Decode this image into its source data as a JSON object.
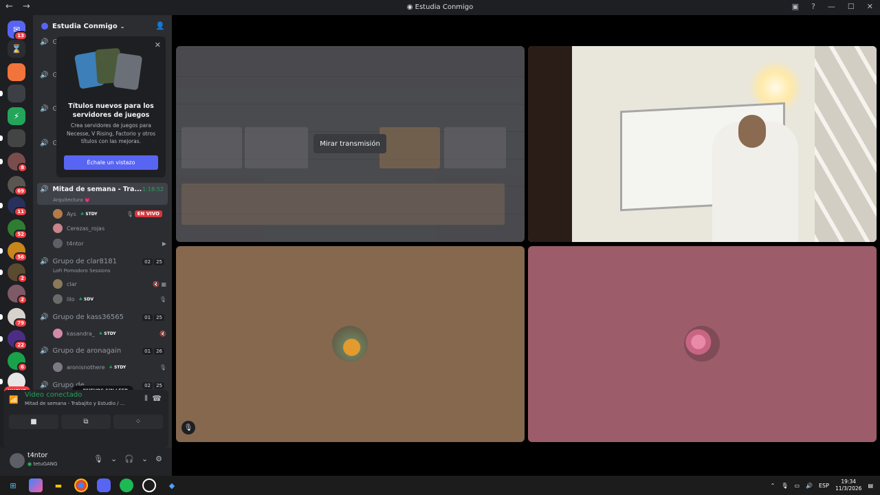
{
  "titlebar": {
    "title": "Estudia Conmigo",
    "back": "←",
    "forward": "→"
  },
  "servers": [
    {
      "color": "#5865f2",
      "glyph": "✉",
      "badge": "13"
    },
    {
      "color": "#2b2d31",
      "glyph": "⌛",
      "badge": ""
    },
    {
      "color": "#f0743b",
      "glyph": "",
      "badge": ""
    },
    {
      "color": "#3c3f44",
      "glyph": "",
      "badge": ""
    },
    {
      "color": "#23a55a",
      "glyph": "⚡",
      "badge": ""
    },
    {
      "color": "#444",
      "glyph": "",
      "badge": ""
    },
    {
      "color": "#7a4d4d",
      "glyph": "",
      "badge": "8"
    },
    {
      "color": "#5a5550",
      "glyph": "",
      "badge": "69"
    },
    {
      "color": "#27315c",
      "glyph": "",
      "badge": "11"
    },
    {
      "color": "#2f7d32",
      "glyph": "",
      "badge": "52"
    },
    {
      "color": "#c9861b",
      "glyph": "",
      "badge": "56"
    },
    {
      "color": "#5a4a2f",
      "glyph": "",
      "badge": "2"
    },
    {
      "color": "#7e5a66",
      "glyph": "",
      "badge": "2"
    },
    {
      "color": "#d8d2cc",
      "glyph": "",
      "badge": "79"
    },
    {
      "color": "#4b2d86",
      "glyph": "",
      "badge": "22"
    },
    {
      "color": "#19a24a",
      "glyph": "",
      "badge": "6"
    },
    {
      "color": "#e6e6e6",
      "glyph": "",
      "badge": ""
    }
  ],
  "nuevo": "NUEVO",
  "server_name": "Estudia Conmigo",
  "promo": {
    "title": "Títulos nuevos para los servidores de juegos",
    "body": "Crea servidores de juegos para Necesse, V Rising, Factorio y otros títulos con las mejoras.",
    "button": "Échale un vistazo"
  },
  "hidden_channel_prefix": [
    "G",
    "G",
    "G",
    "G"
  ],
  "active_channel": {
    "name": "Mitad de semana - Tra...",
    "timer": "1:18:52",
    "subtitle": "Arquitectura 💗"
  },
  "active_users": [
    {
      "name": "Ays",
      "tag": "STDY",
      "live": "EN VIVO"
    },
    {
      "name": "Cerezas_rojas",
      "tag": "",
      "live": ""
    },
    {
      "name": "t4ntor",
      "tag": "",
      "live": ""
    }
  ],
  "groups": [
    {
      "name": "Grupo de clar8181",
      "a": "02",
      "b": "25",
      "subtitle": "LoFi Pomodoro Sessions",
      "users": [
        {
          "name": "clar",
          "tag": ""
        },
        {
          "name": "lilo",
          "tag": "SDV"
        }
      ]
    },
    {
      "name": "Grupo de kass36565",
      "a": "01",
      "b": "25",
      "subtitle": "",
      "users": [
        {
          "name": "kasandra_",
          "tag": "STDY"
        }
      ]
    },
    {
      "name": "Grupo de aronagain",
      "a": "01",
      "b": "26",
      "subtitle": "",
      "users": [
        {
          "name": "aronisnothere",
          "tag": "STDY"
        }
      ]
    },
    {
      "name": "Grupo de ...",
      "a": "02",
      "b": "25",
      "subtitle": "",
      "users": []
    }
  ],
  "unread_pill": "NUEVOS SIN LEER",
  "voice": {
    "status": "Video conectado",
    "channel": "Mitad de semana - Trabajito y Estudio / ..."
  },
  "user": {
    "name": "t4ntor",
    "status": "tetuGANG"
  },
  "stage": {
    "watch_label": "Mirar transmisión"
  },
  "tray": {
    "lang": "ESP",
    "time": "19:34",
    "date": "11/3/2026"
  },
  "colors": {
    "accent": "#5865f2",
    "online": "#23a55a",
    "live": "#da373c"
  }
}
